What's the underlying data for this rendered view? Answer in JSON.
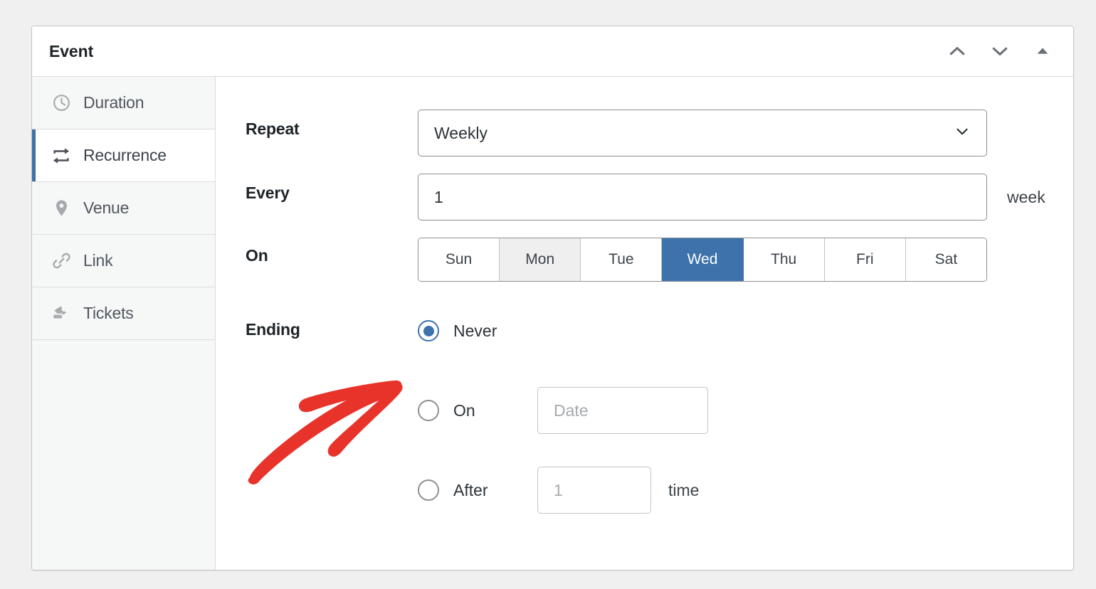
{
  "panel": {
    "title": "Event",
    "header_actions": [
      {
        "name": "move-up-icon",
        "label": "Move up"
      },
      {
        "name": "move-down-icon",
        "label": "Move down"
      },
      {
        "name": "collapse-icon",
        "label": "Collapse"
      }
    ]
  },
  "sidebar": {
    "items": [
      {
        "label": "Duration",
        "icon": "clock-icon",
        "active": false
      },
      {
        "label": "Recurrence",
        "icon": "repeat-icon",
        "active": true
      },
      {
        "label": "Venue",
        "icon": "map-pin-icon",
        "active": false
      },
      {
        "label": "Link",
        "icon": "link-icon",
        "active": false
      },
      {
        "label": "Tickets",
        "icon": "tickets-icon",
        "active": false
      }
    ]
  },
  "form": {
    "repeat": {
      "label": "Repeat",
      "value": "Weekly",
      "options": [
        "Weekly"
      ]
    },
    "every": {
      "label": "Every",
      "value": "1",
      "unit": "week"
    },
    "on": {
      "label": "On",
      "days": [
        {
          "label": "Sun",
          "state": "normal"
        },
        {
          "label": "Mon",
          "state": "hover"
        },
        {
          "label": "Tue",
          "state": "normal"
        },
        {
          "label": "Wed",
          "state": "selected"
        },
        {
          "label": "Thu",
          "state": "normal"
        },
        {
          "label": "Fri",
          "state": "normal"
        },
        {
          "label": "Sat",
          "state": "normal"
        }
      ]
    },
    "ending": {
      "label": "Ending",
      "options": [
        {
          "label": "Never",
          "checked": true
        },
        {
          "label": "On",
          "checked": false,
          "input_placeholder": "Date",
          "input_value": ""
        },
        {
          "label": "After",
          "checked": false,
          "input_placeholder": "1",
          "input_value": "",
          "unit": "time"
        }
      ]
    }
  },
  "annotation": {
    "type": "hand-drawn-arrow",
    "color": "#e8332a",
    "points_to": "Never"
  }
}
